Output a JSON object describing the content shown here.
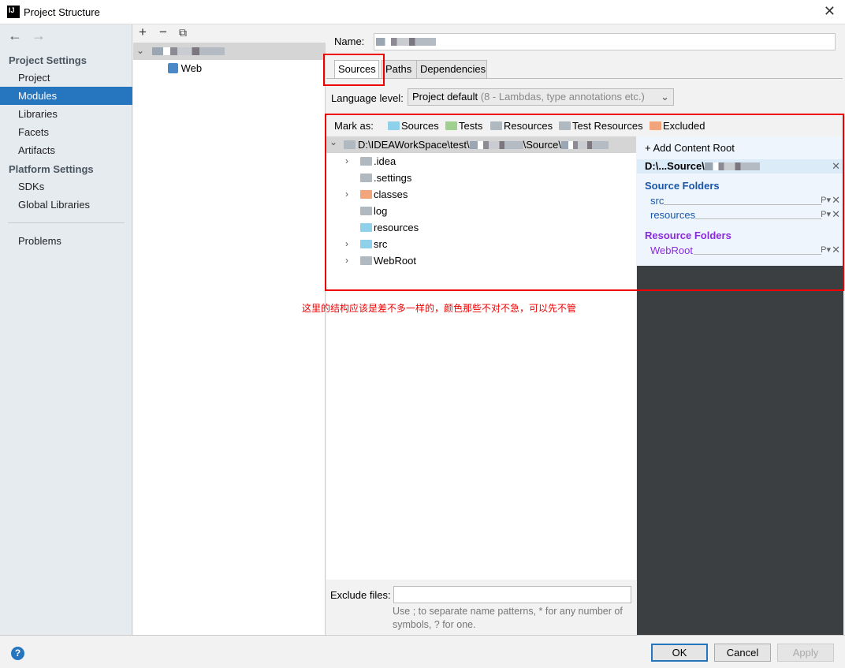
{
  "window": {
    "title": "Project Structure",
    "app_icon": "IJ"
  },
  "sidebar": {
    "project_settings": "Project Settings",
    "items": [
      "Project",
      "Modules",
      "Libraries",
      "Facets",
      "Artifacts"
    ],
    "platform_settings": "Platform Settings",
    "platform_items": [
      "SDKs",
      "Global Libraries"
    ],
    "problems": "Problems",
    "selected": "Modules"
  },
  "modules": {
    "child": "Web"
  },
  "editor": {
    "name_label": "Name:",
    "tabs": [
      "Sources",
      "Paths",
      "Dependencies"
    ],
    "selected_tab": "Sources",
    "language_label": "Language level:",
    "language_value": "Project default",
    "language_hint": "(8 - Lambdas, type annotations etc.)",
    "mark_as": "Mark as:",
    "marks": [
      {
        "label": "Sources",
        "color": "#8fd0ea"
      },
      {
        "label": "Tests",
        "color": "#9fd08f"
      },
      {
        "label": "Resources",
        "color": "#b0b8c0"
      },
      {
        "label": "Test Resources",
        "color": "#b0b8c0"
      },
      {
        "label": "Excluded",
        "color": "#f2a47b"
      }
    ],
    "root_path_prefix": "D:\\IDEAWorkSpace\\test\\",
    "root_path_mid": "\\Source\\",
    "tree": [
      {
        "label": ".idea",
        "expandable": true,
        "color": "#b0b8c0"
      },
      {
        "label": ".settings",
        "expandable": false,
        "color": "#b0b8c0"
      },
      {
        "label": "classes",
        "expandable": true,
        "color": "#f2a47b"
      },
      {
        "label": "log",
        "expandable": false,
        "color": "#b0b8c0"
      },
      {
        "label": "resources",
        "expandable": false,
        "color": "#8fd0ea"
      },
      {
        "label": "src",
        "expandable": true,
        "color": "#8fd0ea"
      },
      {
        "label": "WebRoot",
        "expandable": true,
        "color": "#b0b8c0"
      }
    ],
    "add_content_root": "Add Content Root",
    "content_root": "D:\\...Source\\",
    "source_folders_title": "Source Folders",
    "source_folders": [
      "src",
      "resources"
    ],
    "resource_folders_title": "Resource Folders",
    "resource_folders": [
      "WebRoot"
    ],
    "exclude_label": "Exclude files:",
    "exclude_value": "",
    "exclude_hint": "Use ; to separate name patterns, * for any number of symbols, ? for one."
  },
  "annotation": "这里的结构应该是差不多一样的，颜色那些不对不急，可以先不管",
  "buttons": {
    "ok": "OK",
    "cancel": "Cancel",
    "apply": "Apply"
  },
  "colors": {
    "accent": "#2675bf",
    "annotation": "#e00000",
    "source_title": "#1a56a8",
    "resource_title": "#8a2be2"
  }
}
